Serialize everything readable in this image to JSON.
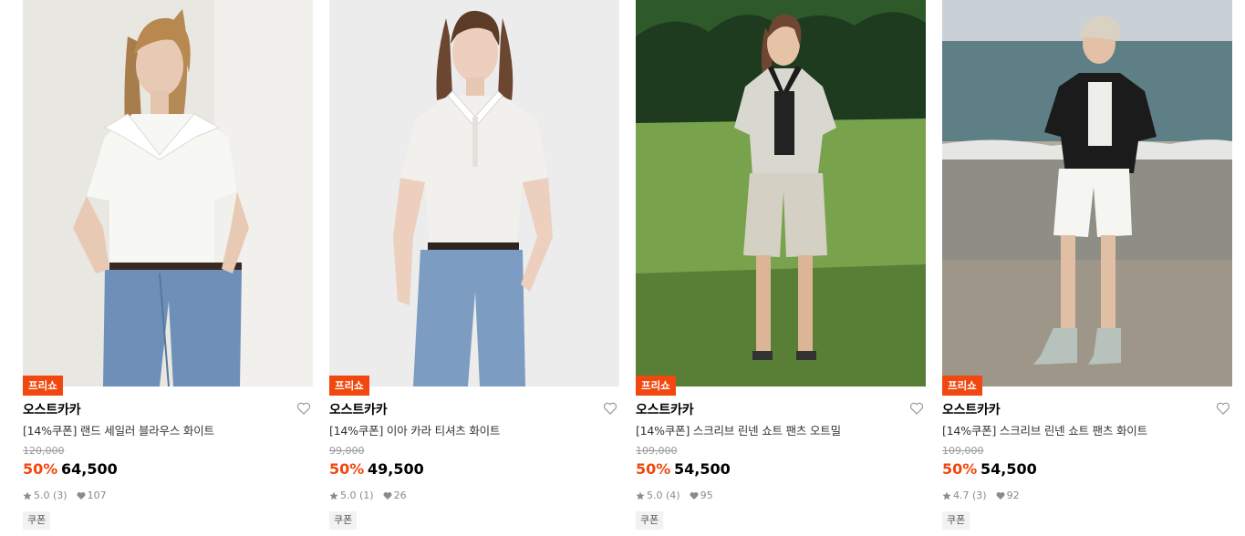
{
  "products": [
    {
      "badge": "프리쇼",
      "brand": "오스트카카",
      "title": "[14%쿠폰] 랜드 세일러 블라우스 화이트",
      "original_price": "120,000",
      "discount": "50%",
      "price": "64,500",
      "rating": "5.0",
      "review_count": "(3)",
      "likes": "107",
      "coupon": "쿠폰",
      "photo_icon": "model-photo-blouse-jeans"
    },
    {
      "badge": "프리쇼",
      "brand": "오스트카카",
      "title": "[14%쿠폰] 이아 카라 티셔츠 화이트",
      "original_price": "99,000",
      "discount": "50%",
      "price": "49,500",
      "rating": "5.0",
      "review_count": "(1)",
      "likes": "26",
      "coupon": "쿠폰",
      "photo_icon": "model-photo-collar-tee"
    },
    {
      "badge": "프리쇼",
      "brand": "오스트카카",
      "title": "[14%쿠폰] 스크리브 린넨 쇼트 팬츠 오트밀",
      "original_price": "109,000",
      "discount": "50%",
      "price": "54,500",
      "rating": "5.0",
      "review_count": "(4)",
      "likes": "95",
      "coupon": "쿠폰",
      "photo_icon": "model-photo-field"
    },
    {
      "badge": "프리쇼",
      "brand": "오스트카카",
      "title": "[14%쿠폰] 스크리브 린넨 쇼트 팬츠 화이트",
      "original_price": "109,000",
      "discount": "50%",
      "price": "54,500",
      "rating": "4.7",
      "review_count": "(3)",
      "likes": "92",
      "coupon": "쿠폰",
      "photo_icon": "model-photo-beach"
    }
  ],
  "colors": {
    "accent": "#f0480f",
    "muted": "#9a9a9a"
  }
}
